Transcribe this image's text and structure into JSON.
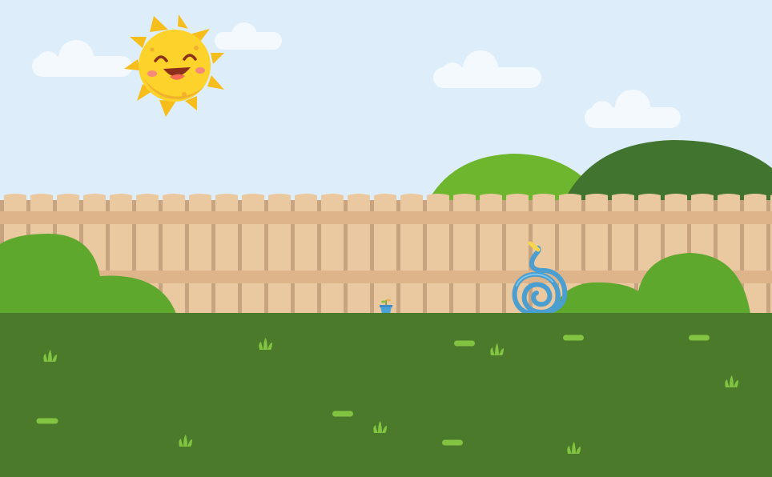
{
  "scene": {
    "colors": {
      "sky": "#ddeefa",
      "cloud": "#f4f9fe",
      "sun_ray": "#f7bd1a",
      "sun_face": "#fcd22b",
      "sun_shade": "#f2b12c",
      "sun_cheek": "#f58a78",
      "sun_mouth": "#8c2f1b",
      "sun_tongue": "#f46a55",
      "hill_light": "#6fb62f",
      "hill_dark": "#41742e",
      "fence_plank": "#eac8a0",
      "fence_rail": "#deb58b",
      "fence_gap": "#c7a37f",
      "bush": "#5fa82e",
      "grass": "#4c7a2b",
      "grass_tuft": "#82c341",
      "hose": "#4a9fd0",
      "hose_highlight": "#7cc4e9",
      "hose_nozzle": "#f7d44a",
      "pot": "#4aa3d8"
    },
    "icons": [
      "sun-icon",
      "cloud-icon",
      "hill-icon",
      "fence-icon",
      "bush-icon",
      "garden-hose-icon",
      "flower-pot-icon",
      "grass-tuft-icon"
    ]
  }
}
